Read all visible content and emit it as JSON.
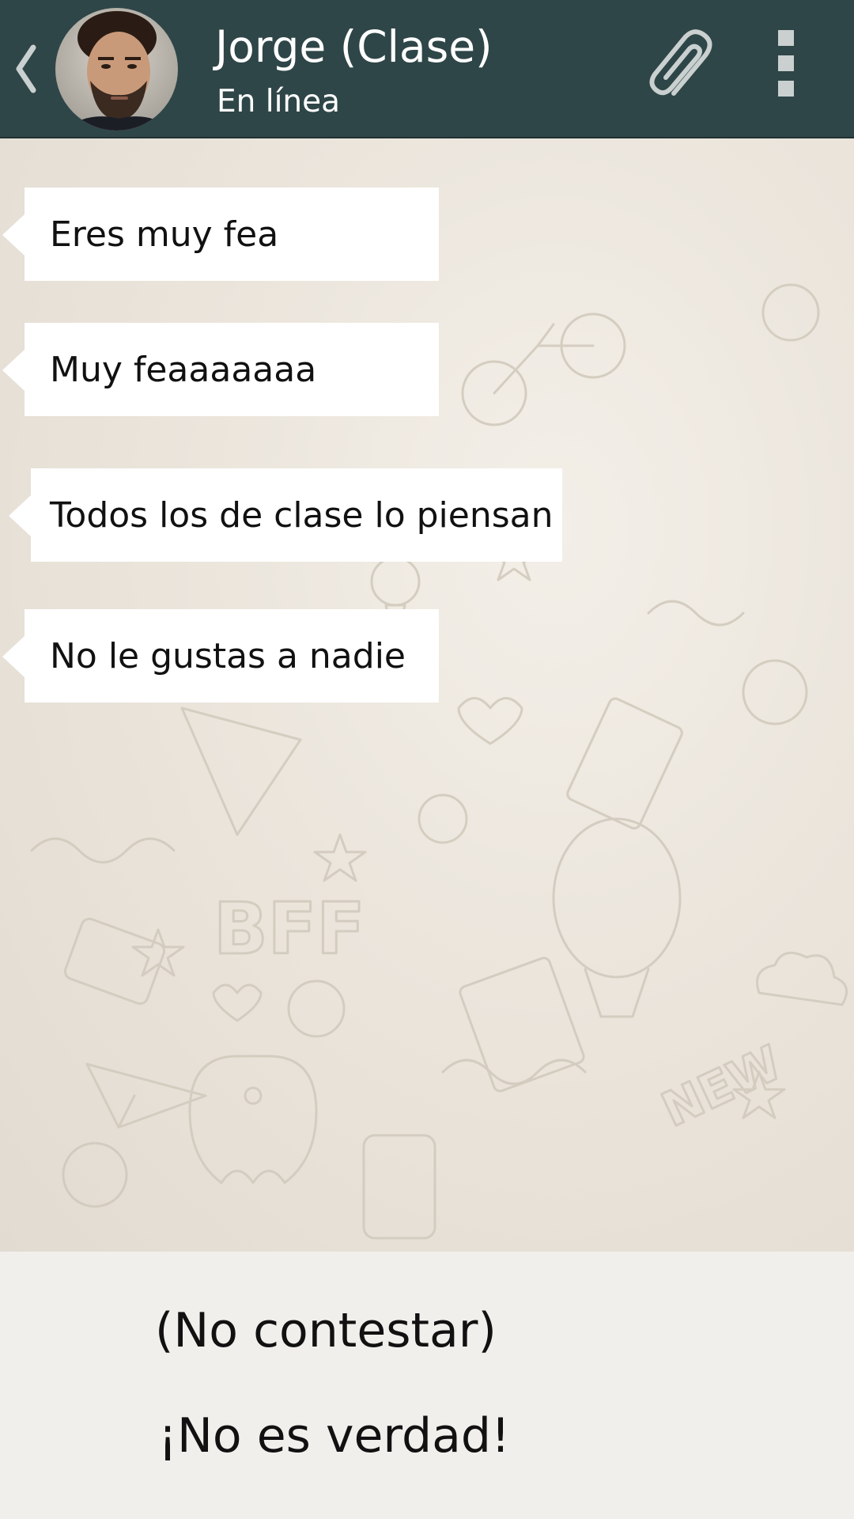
{
  "header": {
    "contact_name": "Jorge (Clase)",
    "status": "En línea",
    "back_icon": "chevron-left-icon",
    "attach_icon": "paperclip-icon",
    "menu_icon": "vertical-dots-icon",
    "background_color": "#2f4648"
  },
  "messages": [
    {
      "text": "Eres muy fea",
      "direction": "incoming"
    },
    {
      "text": "Muy feaaaaaaa",
      "direction": "incoming"
    },
    {
      "text": "Todos los de clase lo piensan",
      "direction": "incoming"
    },
    {
      "text": "No le gustas a nadie",
      "direction": "incoming"
    }
  ],
  "replies": [
    {
      "label": "(No contestar)"
    },
    {
      "label": "¡No es verdad!"
    }
  ]
}
